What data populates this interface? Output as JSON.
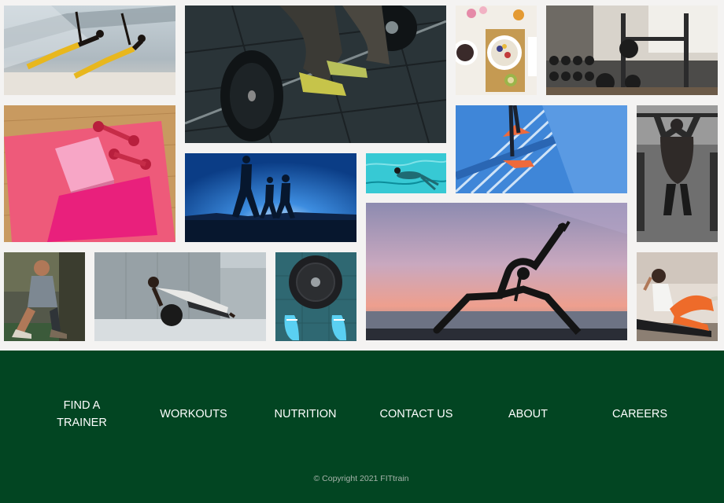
{
  "gallery": {
    "photos": [
      {
        "subject": "two women doing side plank on bridge",
        "colors": [
          "#b9c6cf",
          "#e8b71e"
        ]
      },
      {
        "subject": "man lifting barbell on gym floor",
        "colors": [
          "#283236",
          "#101416"
        ]
      },
      {
        "subject": "healthy breakfast bowls",
        "colors": [
          "#f2eee7",
          "#c59a52"
        ]
      },
      {
        "subject": "gym with dumbbell rack",
        "colors": [
          "#d5d0c8",
          "#2b2b2c"
        ]
      },
      {
        "subject": "pink yoga mat with block and dumbbells",
        "colors": [
          "#c89a60",
          "#ee5a7a"
        ]
      },
      {
        "subject": "runner climbing blue stairs",
        "colors": [
          "#3f86d8",
          "#ee6a3c"
        ]
      },
      {
        "subject": "muscular back doing pull-ups",
        "colors": [
          "#2a2a2a",
          "#6f6f6f"
        ]
      },
      {
        "subject": "three runners silhouetted against blue sky",
        "colors": [
          "#1b64b5",
          "#07172e"
        ]
      },
      {
        "subject": "swimmer in turquoise pool",
        "colors": [
          "#37c9d4",
          "#0c8d9b"
        ]
      },
      {
        "subject": "woman in yoga pose at sunset",
        "colors": [
          "#a89ab6",
          "#e79d8f"
        ]
      },
      {
        "subject": "man tying shoelaces",
        "colors": [
          "#6b6f55",
          "#3b3d2f"
        ]
      },
      {
        "subject": "man doing push-ups on medicine ball",
        "colors": [
          "#97a1a6",
          "#d8dde0"
        ]
      },
      {
        "subject": "weight plate between blue sneakers",
        "colors": [
          "#2f6872",
          "#5ad0f2"
        ]
      },
      {
        "subject": "woman doing crunches in orange leggings",
        "colors": [
          "#e4dcd4",
          "#ee6b2a"
        ]
      }
    ]
  },
  "nav": {
    "find_trainer_line1": "FIND A",
    "find_trainer_line2": "TRAINER",
    "workouts": "WORKOUTS",
    "nutrition": "NUTRITION",
    "contact": "CONTACT US",
    "about": "ABOUT",
    "careers": "CAREERS"
  },
  "footer": {
    "copyright": "© Copyright 2021 FITtrain",
    "background": "#024522"
  }
}
